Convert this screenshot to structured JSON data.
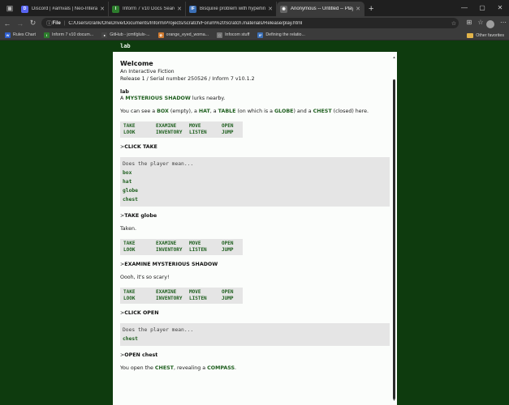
{
  "browser": {
    "tabs": [
      {
        "title": "Discord | #arrivals | Neo-Interactive",
        "fav_color": "#5865f2",
        "fav_glyph": "D",
        "active": false
      },
      {
        "title": "Inform 7 v10 Docs Search",
        "fav_color": "#2d7d2d",
        "fav_glyph": "I",
        "active": false
      },
      {
        "title": "Bisquixe problem with hyperlinks",
        "fav_color": "#3b6fb6",
        "fav_glyph": "IF",
        "active": false
      },
      {
        "title": "Anonymous -- Untitled -- Play",
        "fav_color": "#888888",
        "fav_glyph": "◉",
        "active": true
      }
    ],
    "new_tab": "+",
    "address": {
      "scheme_label": "File",
      "url": "C:/Users/crank/OneDrive/Documents/Inform/Projects/scratch/Forum%20Scratch.materials/Release/play.html"
    },
    "bookmarks": [
      {
        "label": "Rules Chart",
        "color": "#2f5fd0",
        "glyph": "W"
      },
      {
        "label": "Inform 7 v10 docum...",
        "color": "#2d7d2d",
        "glyph": "I"
      },
      {
        "label": "GitHub - jcmf/glulx-...",
        "color": "#444444",
        "glyph": "●"
      },
      {
        "label": "orange_eyed_woma...",
        "color": "#d07a2f",
        "glyph": "✿"
      },
      {
        "label": "Infocom stuff",
        "color": "#777777",
        "glyph": "□"
      },
      {
        "label": "Defining the relatio...",
        "color": "#3b6fb6",
        "glyph": "IF"
      }
    ],
    "other_favorites": "Other favorites"
  },
  "game": {
    "status_room": "lab",
    "banner_title": "Welcome",
    "banner_sub": "An Interactive Fiction",
    "banner_release": "Release 1 / Serial number 250526 / Inform 7 v10.1.2",
    "room_name": "lab",
    "shadow": {
      "pre": "A ",
      "kw": "MYSTERIOUS SHADOW",
      "post": " lurks nearby."
    },
    "look": {
      "t1": "You can see a ",
      "box": "BOX",
      "t2": " (empty), a ",
      "hat": "HAT",
      "t3": ", a ",
      "table": "TABLE",
      "t4": " (on which is a ",
      "globe": "GLOBE",
      "t5": ") and a ",
      "chest": "CHEST",
      "t6": " (closed) here."
    },
    "verbs": [
      [
        "TAKE",
        "EXAMINE",
        "MOVE",
        "OPEN"
      ],
      [
        "LOOK",
        "INVENTORY",
        "LISTEN",
        "JUMP"
      ]
    ],
    "prompt": ">",
    "cmd1": "CLICK TAKE",
    "does_mean": "Does the player mean...",
    "options1": [
      "box",
      "hat",
      "globe",
      "chest"
    ],
    "cmd2": "TAKE globe",
    "taken": "Taken.",
    "cmd3": "EXAMINE MYSTERIOUS SHADOW",
    "scary": "Oooh, it's so scary!",
    "cmd4": "CLICK OPEN",
    "options2": [
      "chest"
    ],
    "cmd5": "OPEN chest",
    "open_result": {
      "t1": "You open the ",
      "chest": "CHEST",
      "t2": ", revealing a ",
      "compass": "COMPASS",
      "t3": "."
    }
  }
}
